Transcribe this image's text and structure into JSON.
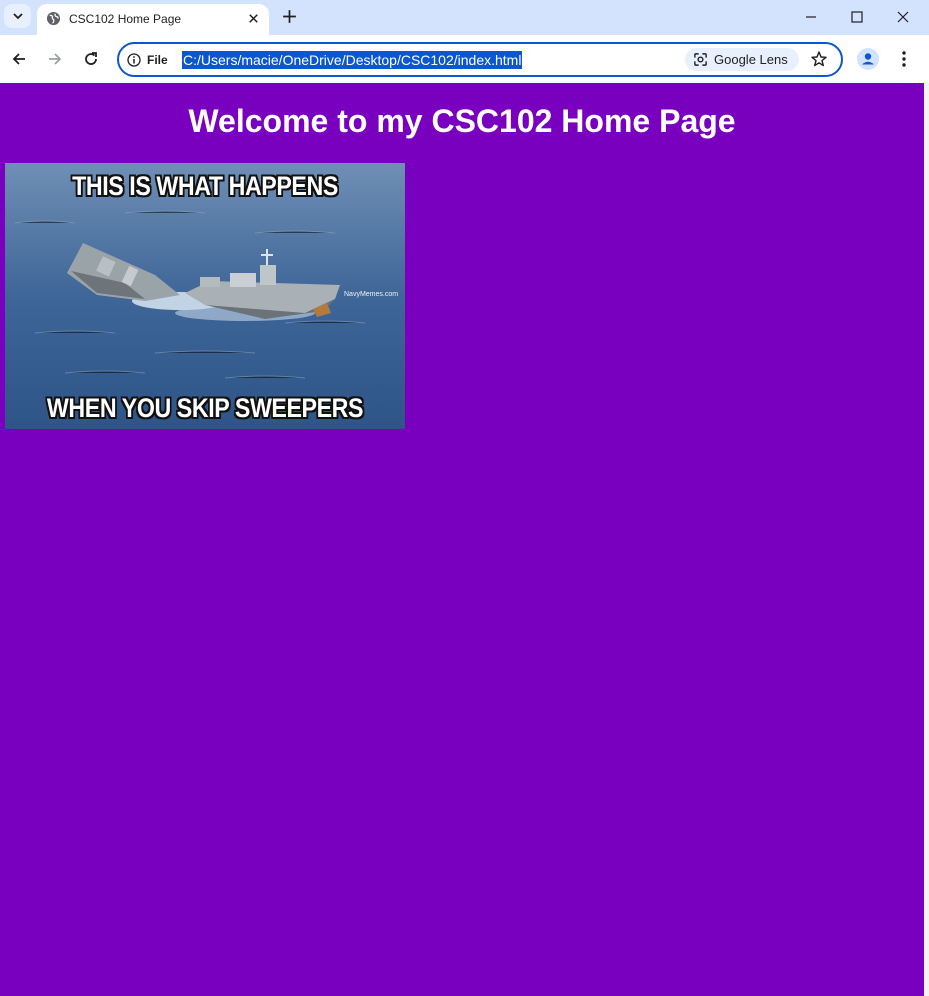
{
  "browser": {
    "tab": {
      "title": "CSC102 Home Page"
    },
    "address_bar": {
      "security_chip": "File",
      "url": "C:/Users/macie/OneDrive/Desktop/CSC102/index.html",
      "lens_label": "Google Lens"
    },
    "colors": {
      "tab_strip": "#d3e3fd",
      "accent": "#0b57d0"
    }
  },
  "page": {
    "heading": "Welcome to my CSC102 Home Page",
    "background_color": "#7a00bf",
    "meme": {
      "top_text": "THIS IS WHAT HAPPENS",
      "bottom_text": "WHEN YOU SKIP SWEEPERS",
      "watermark": "NavyMemes.com"
    }
  },
  "icons": [
    "tab-search-icon",
    "globe-icon",
    "close-icon",
    "plus-icon",
    "minimize-icon",
    "maximize-icon",
    "window-close-icon",
    "back-arrow-icon",
    "forward-arrow-icon",
    "reload-icon",
    "info-icon",
    "lens-icon",
    "star-icon",
    "profile-icon",
    "kebab-menu-icon"
  ]
}
